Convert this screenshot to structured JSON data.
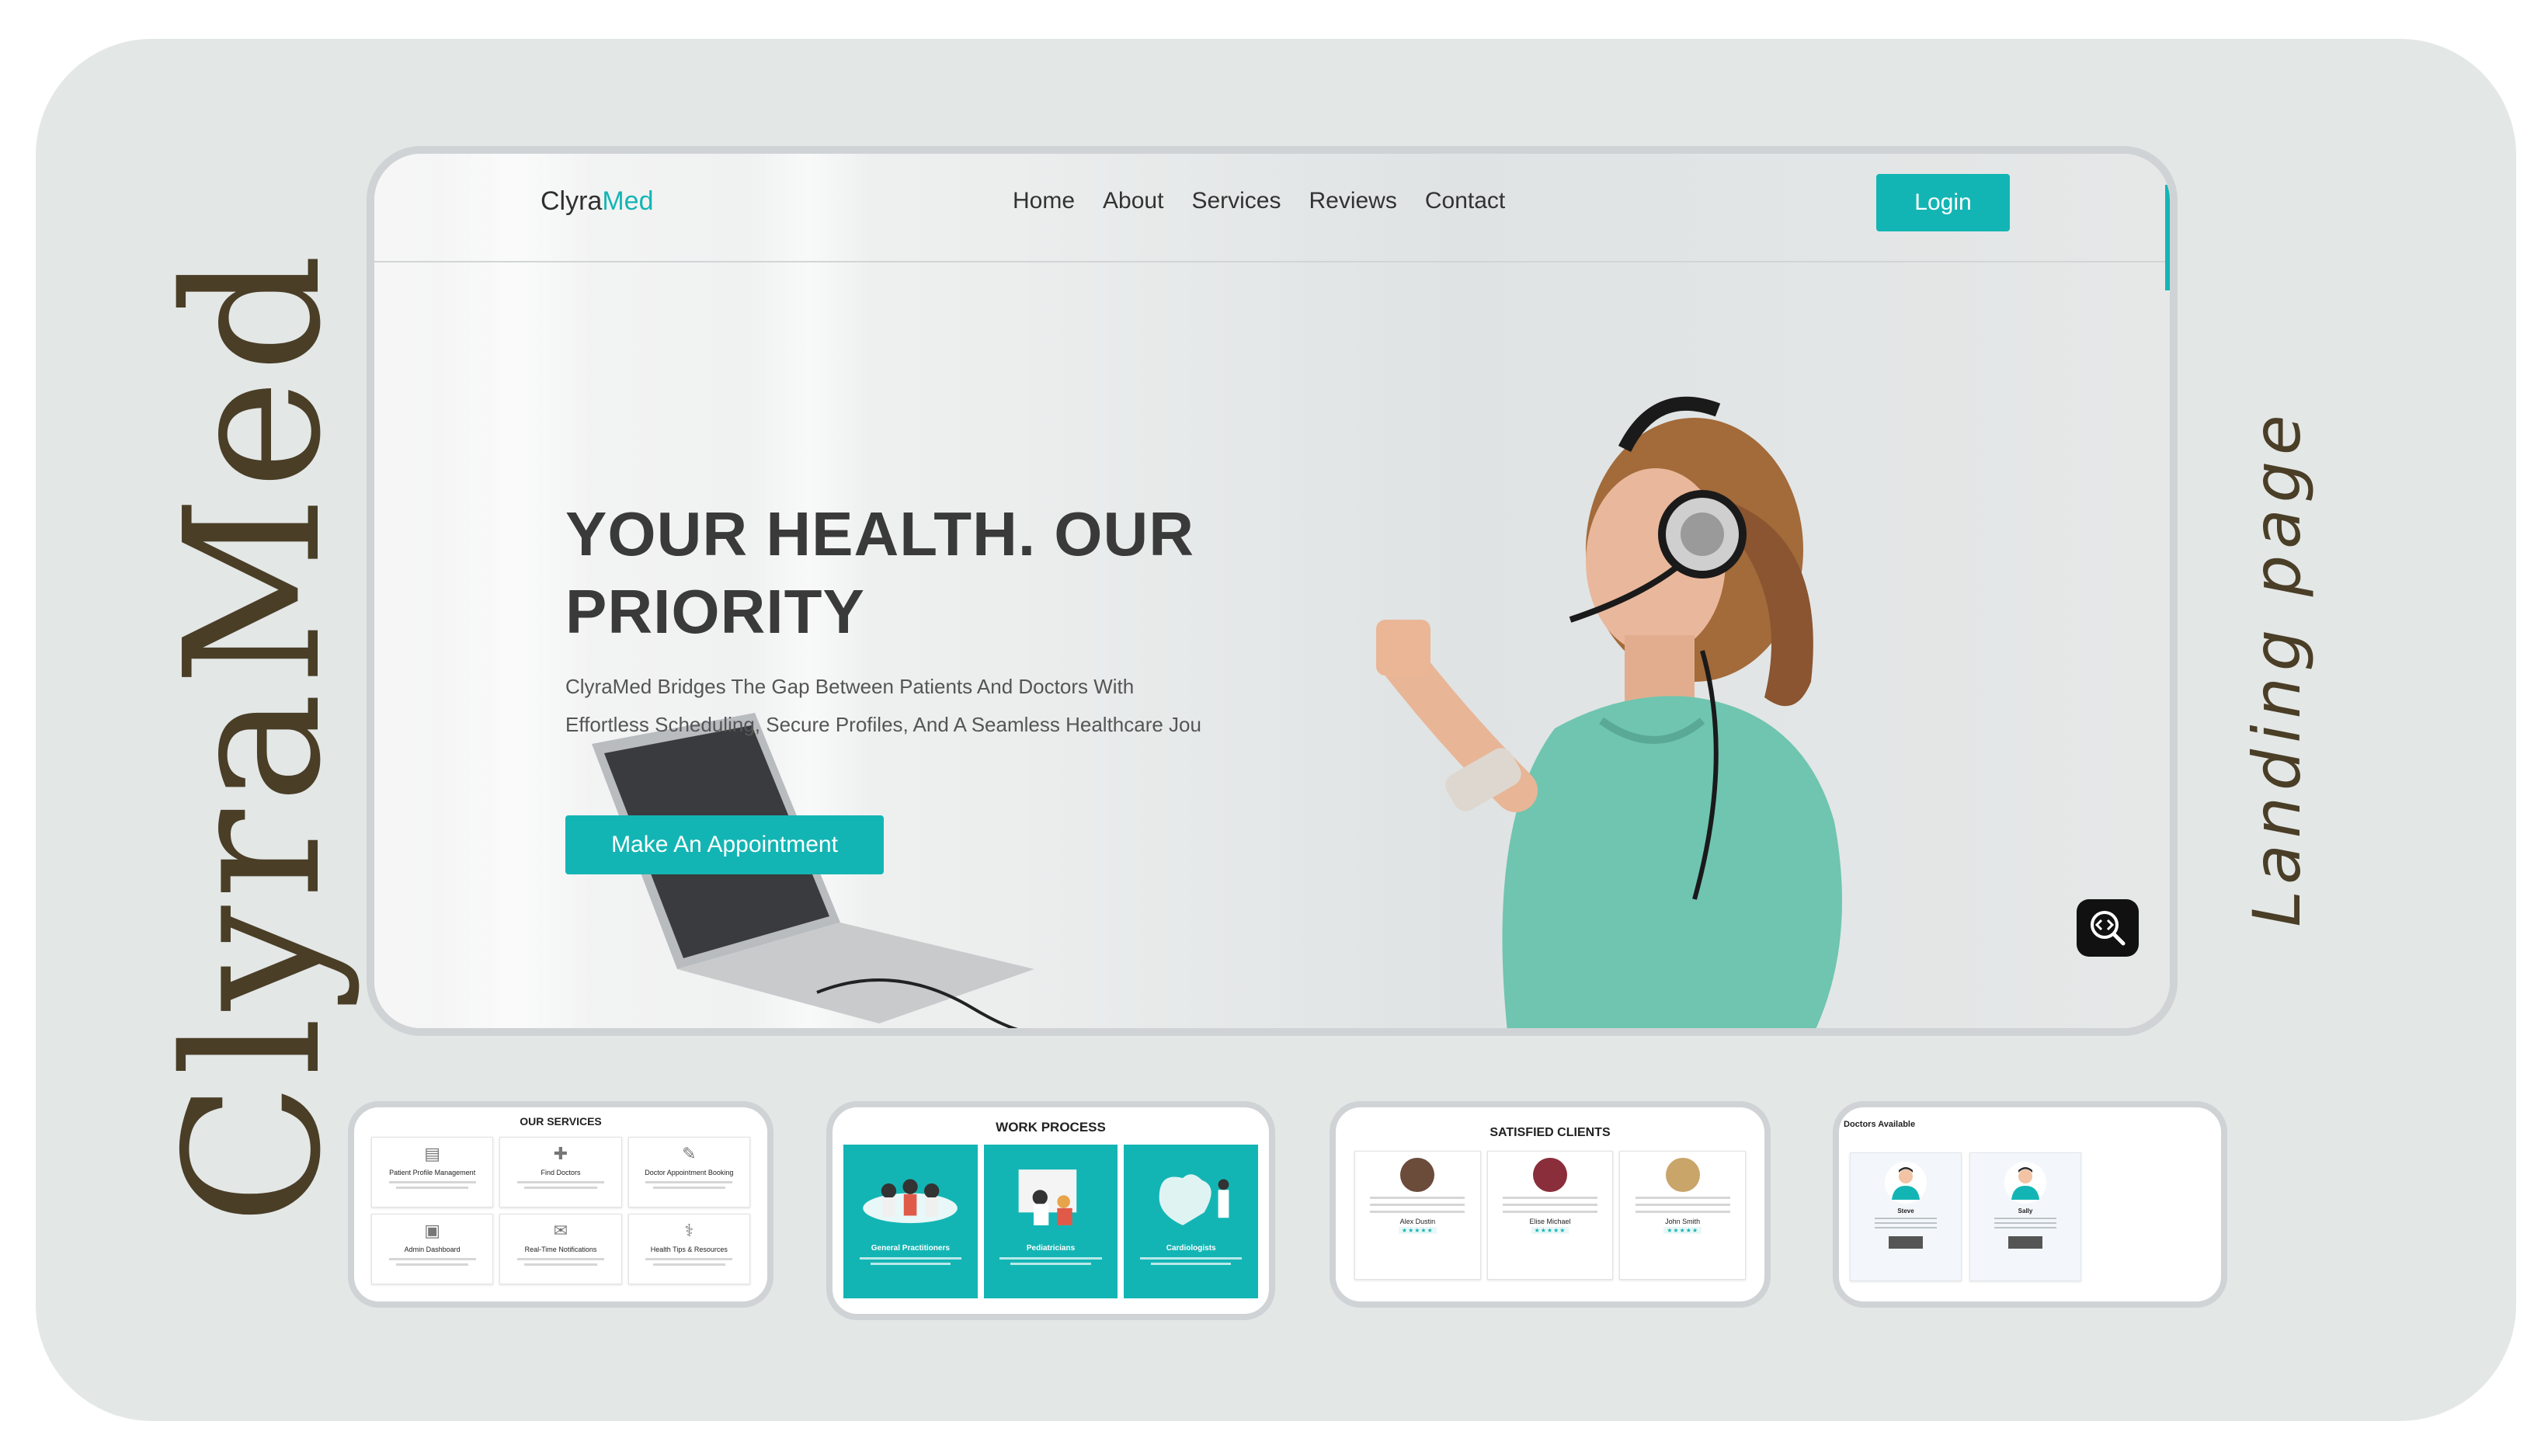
{
  "showcase": {
    "brand_vertical": "ClyraMed",
    "tagline_vertical": "Landing page"
  },
  "hero": {
    "logo_primary": "Clyra",
    "logo_accent": "Med",
    "nav": [
      "Home",
      "About",
      "Services",
      "Reviews",
      "Contact"
    ],
    "login_label": "Login",
    "headline": "YOUR HEALTH. OUR PRIORITY",
    "subtext": "ClyraMed Bridges The Gap Between Patients And Doctors With Effortless Scheduling, Secure Profiles, And A Seamless Healthcare Jou",
    "cta_label": "Make An Appointment"
  },
  "thumbnails": {
    "services": {
      "title": "OUR SERVICES",
      "cards": [
        "Patient Profile Management",
        "Find Doctors",
        "Doctor Appointment Booking",
        "Admin Dashboard",
        "Real-Time Notifications",
        "Health Tips & Resources"
      ]
    },
    "work_process": {
      "title": "WORK PROCESS",
      "cards": [
        "General Practitioners",
        "Pediatricians",
        "Cardiologists"
      ]
    },
    "clients": {
      "title": "SATISFIED CLIENTS",
      "names": [
        "Alex Dustin",
        "Elise Michael",
        "John Smith"
      ]
    },
    "doctors": {
      "title": "Doctors Available",
      "names": [
        "Steve",
        "Sally"
      ]
    }
  },
  "colors": {
    "accent": "#13b5b4",
    "brand_text": "#4a3e27",
    "board": "#e3e7e6"
  }
}
